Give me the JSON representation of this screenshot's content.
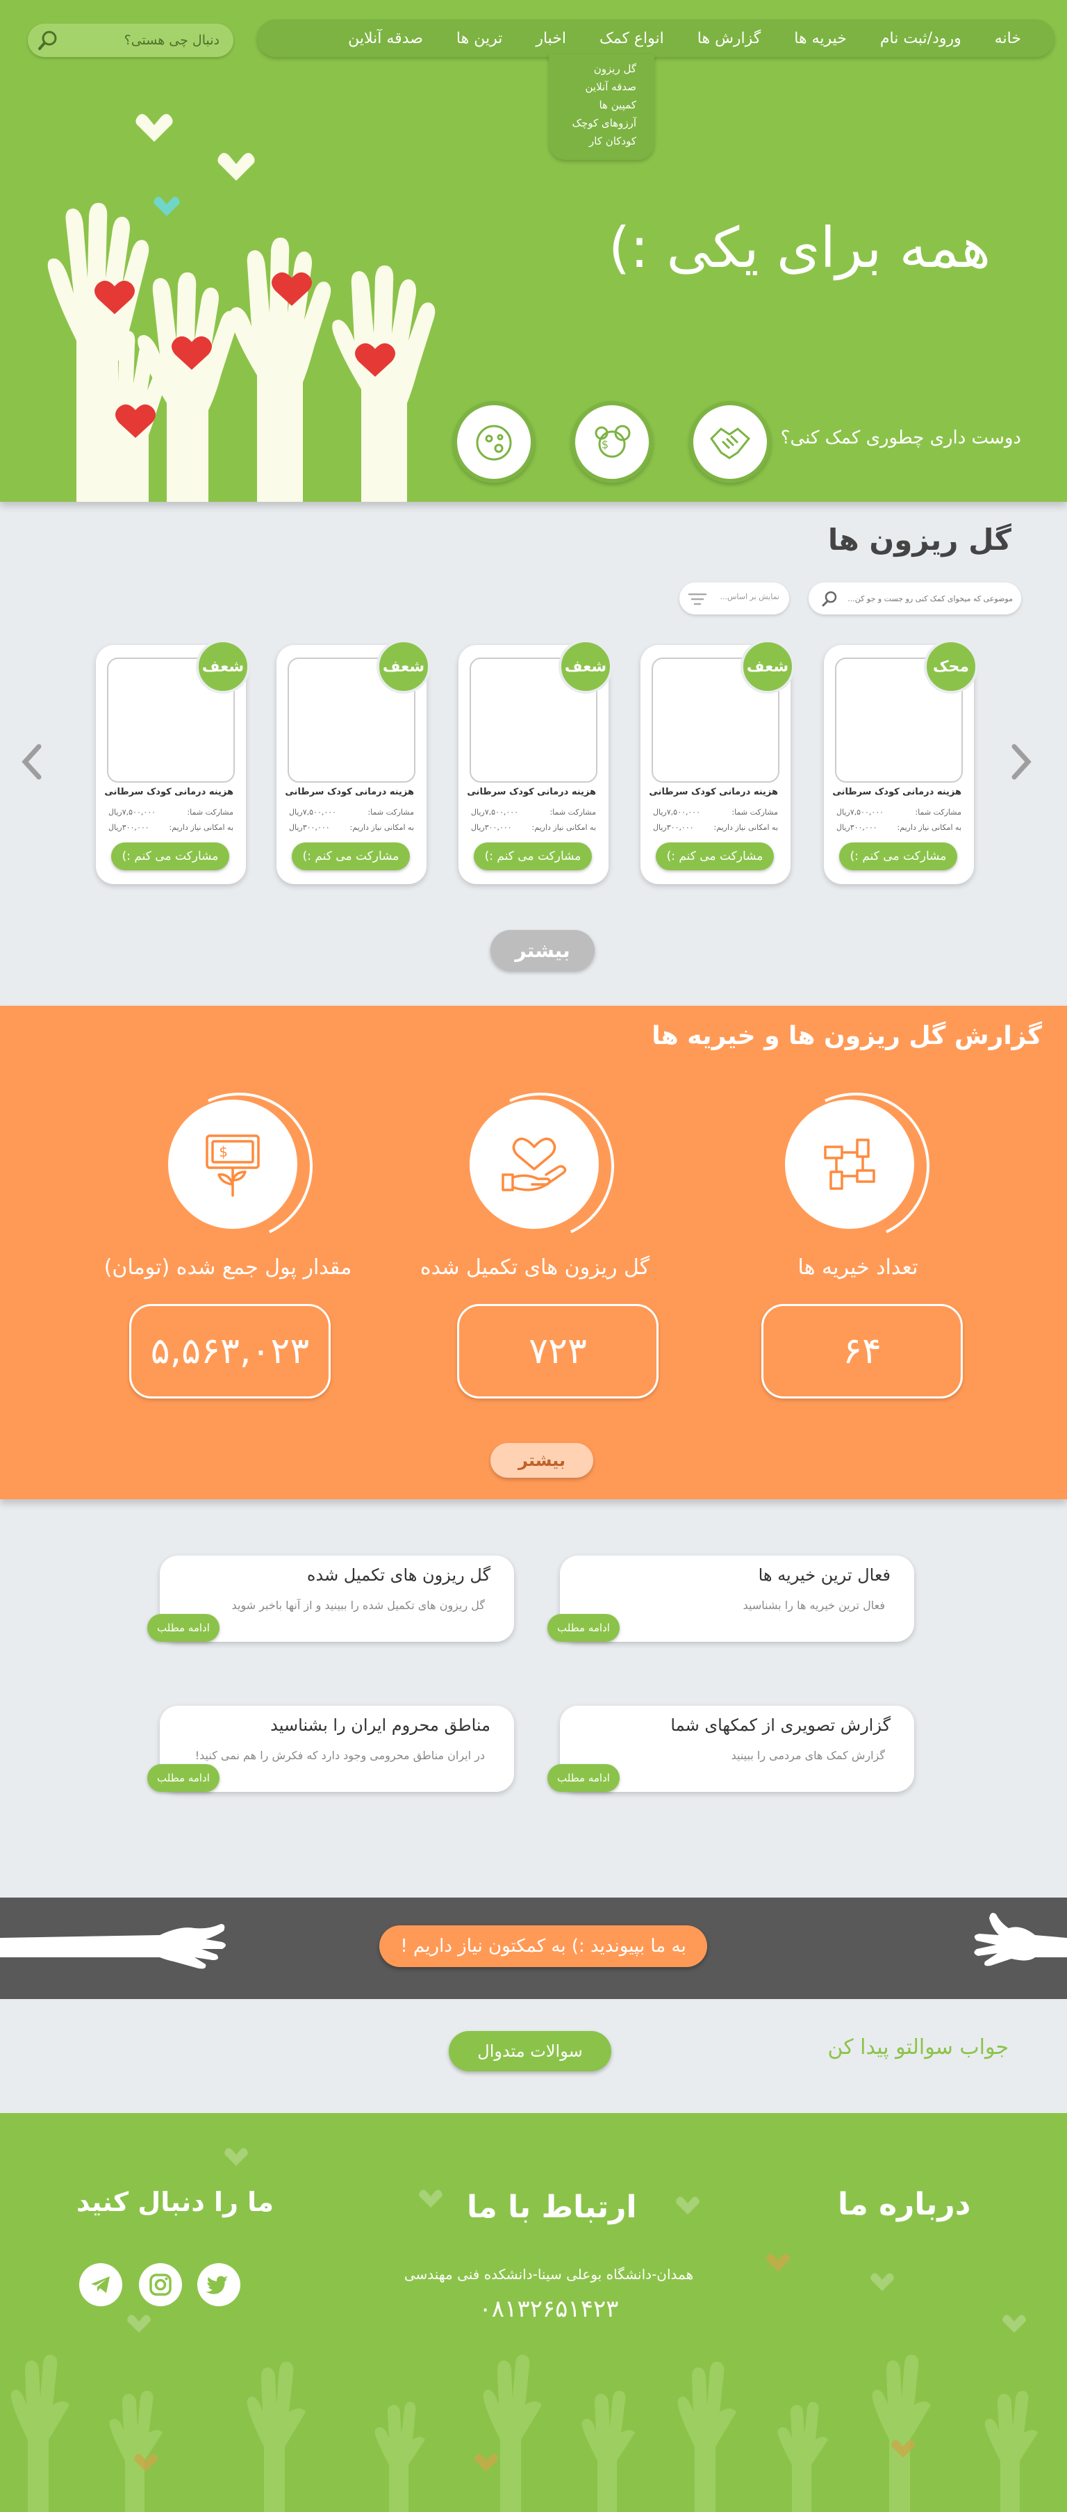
{
  "nav": {
    "items": [
      "خانه",
      "ورود/ثبت نام",
      "خیریه ها",
      "گزارش ها",
      "انواع کمک",
      "اخبار",
      "ترین ها",
      "صدقه آنلاین"
    ],
    "search_placeholder": "دنبال چی هستی؟",
    "dropdown": [
      "گل ریزون",
      "صدقه آنلاین",
      "کمپین ها",
      "آرزوهای کوچک",
      "کودکان کار"
    ]
  },
  "hero": {
    "title": "همه برای یکی :)",
    "question": "دوست داری چطوری کمک کنی؟"
  },
  "campaigns": {
    "title": "گل ریزون ها",
    "search_placeholder": "موضوعی که میخوای کمک کنی رو جست و جو کن...",
    "filter_placeholder": "نمایش بر اساس...",
    "more_label": "بیشتر",
    "cards": [
      {
        "badge": "محک",
        "name": "هزینه درمانی کودک سرطانی",
        "row1_label": "مشارکت شما:",
        "row1_value": "۷,۵۰۰,۰۰۰ریال",
        "row2_label": "به امکانی نیاز داریم:",
        "row2_value": "۳۰۰,۰۰۰ریال",
        "button": "مشارکت می کنم :)"
      },
      {
        "badge": "شعف",
        "name": "هزینه درمانی کودک سرطانی",
        "row1_label": "مشارکت شما:",
        "row1_value": "۷,۵۰۰,۰۰۰ریال",
        "row2_label": "به امکانی نیاز داریم:",
        "row2_value": "۳۰۰,۰۰۰ریال",
        "button": "مشارکت می کنم :)"
      },
      {
        "badge": "شعف",
        "name": "هزینه درمانی کودک سرطانی",
        "row1_label": "مشارکت شما:",
        "row1_value": "۷,۵۰۰,۰۰۰ریال",
        "row2_label": "به امکانی نیاز داریم:",
        "row2_value": "۳۰۰,۰۰۰ریال",
        "button": "مشارکت می کنم :)"
      },
      {
        "badge": "شعف",
        "name": "هزینه درمانی کودک سرطانی",
        "row1_label": "مشارکت شما:",
        "row1_value": "۷,۵۰۰,۰۰۰ریال",
        "row2_label": "به امکانی نیاز داریم:",
        "row2_value": "۳۰۰,۰۰۰ریال",
        "button": "مشارکت می کنم :)"
      },
      {
        "badge": "شعف",
        "name": "هزینه درمانی کودک سرطانی",
        "row1_label": "مشارکت شما:",
        "row1_value": "۷,۵۰۰,۰۰۰ریال",
        "row2_label": "به امکانی نیاز داریم:",
        "row2_value": "۳۰۰,۰۰۰ریال",
        "button": "مشارکت می کنم :)"
      }
    ]
  },
  "report": {
    "title": "گزارش گل ریزون ها و خیریه ها",
    "stats": [
      {
        "label": "تعداد خیریه ها",
        "value": "۶۴"
      },
      {
        "label": "گل ریزون های تکمیل شده",
        "value": "۷۲۳"
      },
      {
        "label": "مقدار پول جمع شده (تومان)",
        "value": "۵,۵۶۳,۰۲۳"
      }
    ],
    "more_label": "بیشتر"
  },
  "info": [
    {
      "title": "فعال ترین خیریه ها",
      "sub": "فعال ترین خیریه ها را بشناسید",
      "button": "ادامه مطلب"
    },
    {
      "title": "گل ریزون های تکمیل شده",
      "sub": "گل ریزون های تکمیل شده را ببینید و از آنها باخبر شوید",
      "button": "ادامه مطلب"
    },
    {
      "title": "گزارش تصویری از کمکهای شما",
      "sub": "گزارش کمک های مردمی را ببینید",
      "button": "ادامه مطلب"
    },
    {
      "title": "مناطق محروم ایران را بشناسید",
      "sub": "در ایران مناطق محرومی وجود دارد که فکرش را هم نمی کنید!",
      "button": "ادامه مطلب"
    }
  ],
  "join": {
    "label": "به ما بپیوندید :) به کمکتون نیاز داریم !"
  },
  "faq": {
    "text": "جواب سوالتو پیدا کن",
    "button": "سوالات متدوال"
  },
  "footer": {
    "about_title": "درباره ما",
    "contact_title": "ارتباط با ما",
    "follow_title": "ما را دنبال کنید",
    "address": "همدان-دانشگاه بوعلی سینا-دانشکده فنی مهندسی",
    "phone": "۰۸۱۳۲۶۵۱۴۲۳"
  },
  "colors": {
    "green": "#8bc34a",
    "dark_green": "#7cb342",
    "orange": "#ff9a56",
    "gray_bar": "#595959",
    "bg": "#e9ecef"
  }
}
